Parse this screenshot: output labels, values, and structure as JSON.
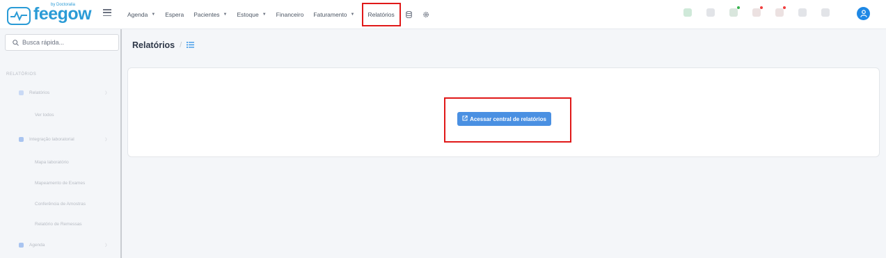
{
  "brand": {
    "name": "feegow",
    "subtitle": "by Doctoralia"
  },
  "nav": {
    "items": [
      {
        "label": "Agenda",
        "caret": true
      },
      {
        "label": "Espera",
        "caret": false
      },
      {
        "label": "Pacientes",
        "caret": true
      },
      {
        "label": "Estoque",
        "caret": true
      },
      {
        "label": "Financeiro",
        "caret": false
      },
      {
        "label": "Faturamento",
        "caret": true
      },
      {
        "label": "Relatórios",
        "caret": false,
        "active": true
      }
    ],
    "icons": [
      "database-icon",
      "gear-icon"
    ]
  },
  "top_icons": [
    {
      "name": "whatsapp-icon",
      "color": "#cfe9d9"
    },
    {
      "name": "tag-icon",
      "color": "#e2e4e8"
    },
    {
      "name": "chat-icon",
      "color": "#d9e6dd",
      "dot": "#37b24d"
    },
    {
      "name": "bell-icon",
      "color": "#ece1e1",
      "dot": "#f03e3e"
    },
    {
      "name": "message-icon",
      "color": "#ece1e1",
      "dot": "#f03e3e"
    },
    {
      "name": "calendar-icon",
      "color": "#e2e4e8"
    },
    {
      "name": "grid-icon",
      "color": "#e2e4e8"
    }
  ],
  "search": {
    "placeholder": "Busca rápida..."
  },
  "sidebar": {
    "section": "RELATÓRIOS",
    "items": [
      {
        "label": "Relatórios",
        "level": 0,
        "dot": "#c9d9f5"
      },
      {
        "label": "Ver todos",
        "level": 1
      },
      {
        "label": "Integração laboratorial",
        "level": 0,
        "dot": "#a9c4f0"
      },
      {
        "label": "Mapa laboratório",
        "level": 1
      },
      {
        "label": "Mapeamento de Exames",
        "level": 1
      },
      {
        "label": "Conferência de Amostras",
        "level": 1
      },
      {
        "label": "Relatório de Remessas",
        "level": 1
      },
      {
        "label": "Agenda",
        "level": 0,
        "dot": "#a9c4f0"
      }
    ]
  },
  "page": {
    "title": "Relatórios",
    "separator": "/",
    "action_button": "Acessar central de relatórios"
  },
  "colors": {
    "accent": "#1e88e5",
    "button": "#4a90e2",
    "highlight": "#e01818"
  }
}
